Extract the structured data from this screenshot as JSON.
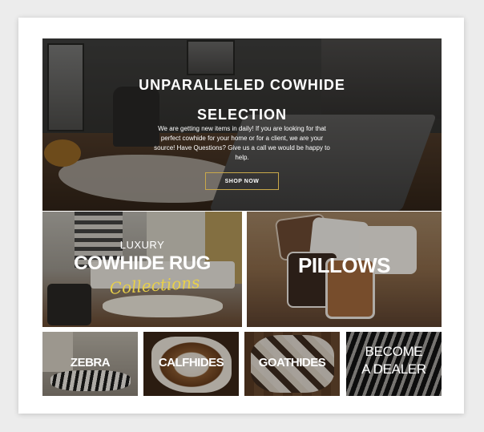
{
  "hero": {
    "title": "UNPARALLELED COWHIDE SELECTION",
    "description": "We are getting new items in daily! If you are looking for that perfect cowhide for your home or for a client, we are your source! Have Questions? Give us a call we would be happy to help.",
    "button_label": "SHOP NOW"
  },
  "tiles": {
    "rugs": {
      "eyebrow": "LUXURY",
      "title": "COWHIDE RUG",
      "script": "Collections"
    },
    "pillows": {
      "title": "PILLOWS"
    },
    "zebra": {
      "title": "ZEBRA"
    },
    "calfhides": {
      "title": "CALFHIDES"
    },
    "goathides": {
      "title": "GOATHIDES"
    },
    "dealer": {
      "line1": "BECOME",
      "line2": "A DEALER"
    }
  },
  "colors": {
    "button_border": "#c9a84a",
    "script_accent": "#e8d04a",
    "page_bg": "#ececec",
    "card_bg": "#ffffff"
  }
}
